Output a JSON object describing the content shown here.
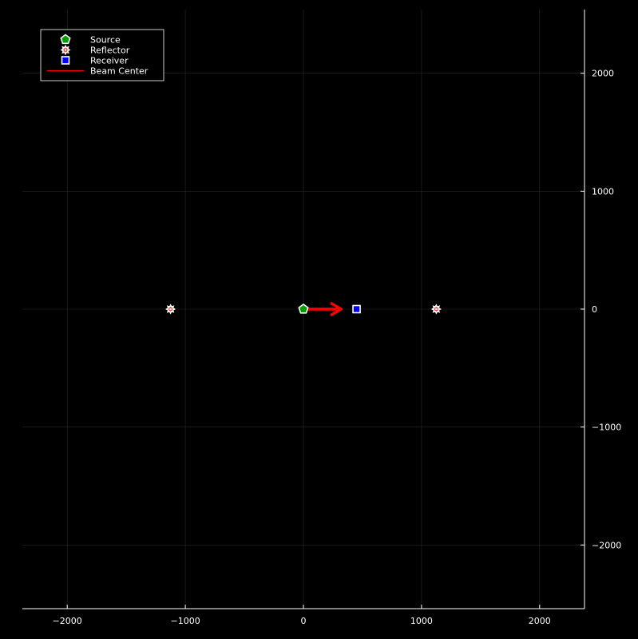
{
  "chart_data": {
    "type": "scatter",
    "title": "",
    "xlabel": "",
    "ylabel": "",
    "xlim": [
      -2380,
      2380
    ],
    "ylim": [
      -2540,
      2540
    ],
    "xticks": [
      -2000,
      -1000,
      0,
      1000,
      2000
    ],
    "yticks": [
      -2000,
      -1000,
      0,
      1000,
      2000
    ],
    "xtick_labels": [
      "−2000",
      "−1000",
      "0",
      "1000",
      "2000"
    ],
    "ytick_labels": [
      "−2000",
      "−1000",
      "0",
      "1000",
      "2000"
    ],
    "grid": true,
    "legend_position": "top-left",
    "series": [
      {
        "name": "Source",
        "marker": "pentagon",
        "color": "#00a000",
        "points": [
          [
            0,
            0
          ]
        ]
      },
      {
        "name": "Reflector",
        "marker": "star",
        "color": "#ffffff",
        "points": [
          [
            -1125,
            0
          ],
          [
            1125,
            0
          ]
        ]
      },
      {
        "name": "Receiver",
        "marker": "square",
        "color": "#0000ff",
        "points": [
          [
            450,
            0
          ]
        ]
      },
      {
        "name": "Beam Center",
        "marker": "line",
        "color": "#ff0000",
        "points": []
      }
    ],
    "annotations": [
      {
        "type": "arrow",
        "color": "#ff0000",
        "from": [
          0,
          0
        ],
        "to": [
          320,
          0
        ]
      }
    ]
  }
}
